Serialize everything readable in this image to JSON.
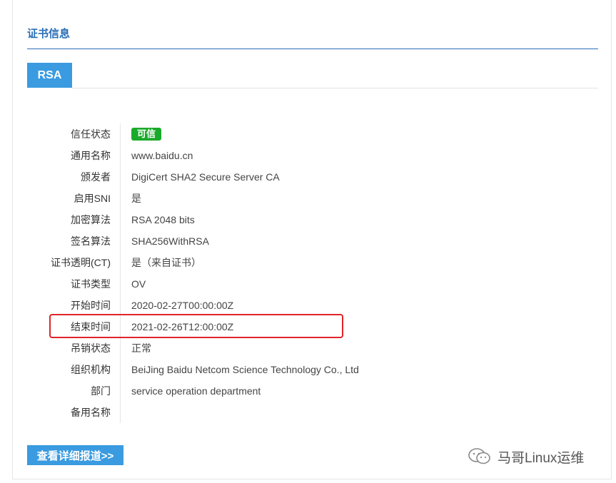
{
  "section": {
    "title": "证书信息"
  },
  "tabs": [
    {
      "label": "RSA"
    }
  ],
  "details": [
    {
      "label": "信任状态",
      "value": "可信"
    },
    {
      "label": "通用名称",
      "value": "www.baidu.cn"
    },
    {
      "label": "颁发者",
      "value": "DigiCert SHA2 Secure Server CA"
    },
    {
      "label": "启用SNI",
      "value": "是"
    },
    {
      "label": "加密算法",
      "value": "RSA 2048 bits"
    },
    {
      "label": "签名算法",
      "value": "SHA256WithRSA"
    },
    {
      "label": "证书透明(CT)",
      "value": "是（来自证书）"
    },
    {
      "label": "证书类型",
      "value": "OV"
    },
    {
      "label": "开始时间",
      "value": "2020-02-27T00:00:00Z"
    },
    {
      "label": "结束时间",
      "value": "2021-02-26T12:00:00Z"
    },
    {
      "label": "吊销状态",
      "value": "正常"
    },
    {
      "label": "组织机构",
      "value": "BeiJing Baidu Netcom Science Technology Co., Ltd"
    },
    {
      "label": "部门",
      "value": "service operation department"
    },
    {
      "label": "备用名称",
      "value": ""
    }
  ],
  "actions": {
    "detail_report_label": "查看详细报道>>"
  },
  "watermark": {
    "text": "马哥Linux运维",
    "icon": "wechat-icon"
  },
  "colors": {
    "accent": "#3a9be0",
    "title": "#2a6fb7",
    "trusted_badge": "#1aaa2a",
    "highlight": "#e0242a"
  }
}
